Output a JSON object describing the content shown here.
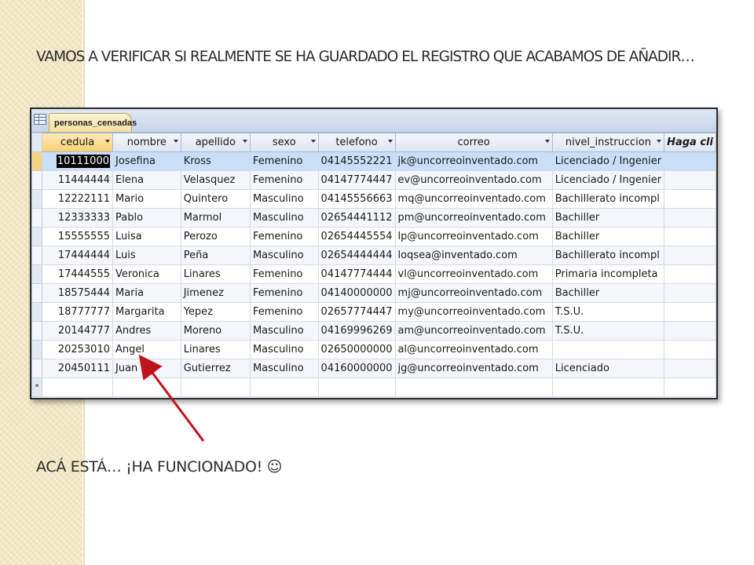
{
  "heading": "VAMOS A VERIFICAR SI REALMENTE SE HA GUARDADO EL REGISTRO QUE ACABAMOS DE AÑADIR…",
  "footer_message": "ACÁ ESTÁ… ¡HA FUNCIONADO! ☺",
  "tab": {
    "label": "personas_censadas",
    "icon": "table-icon"
  },
  "columns": [
    {
      "label": "cedula"
    },
    {
      "label": "nombre"
    },
    {
      "label": "apellido"
    },
    {
      "label": "sexo"
    },
    {
      "label": "telefono"
    },
    {
      "label": "correo"
    },
    {
      "label": "nivel_instruccion"
    },
    {
      "label": "Haga cli"
    }
  ],
  "rows": [
    [
      "10111000",
      "Josefina",
      "Kross",
      "Femenino",
      "04145552221",
      "jk@uncorreoinventado.com",
      "Licenciado / Ingenier",
      ""
    ],
    [
      "11444444",
      "Elena",
      "Velasquez",
      "Femenino",
      "04147774447",
      "ev@uncorreoinventado.com",
      "Licenciado / Ingenier",
      ""
    ],
    [
      "12222111",
      "Mario",
      "Quintero",
      "Masculino",
      "04145556663",
      "mq@uncorreoinventado.com",
      "Bachillerato incompl",
      ""
    ],
    [
      "12333333",
      "Pablo",
      "Marmol",
      "Masculino",
      "02654441112",
      "pm@uncorreoinventado.com",
      "Bachiller",
      ""
    ],
    [
      "15555555",
      "Luisa",
      "Perozo",
      "Femenino",
      "02654445554",
      "lp@uncorreoinventado.com",
      "Bachiller",
      ""
    ],
    [
      "17444444",
      "Luis",
      "Peña",
      "Masculino",
      "02654444444",
      "loqsea@inventado.com",
      "Bachillerato incompl",
      ""
    ],
    [
      "17444555",
      "Veronica",
      "Linares",
      "Femenino",
      "04147774444",
      "vl@uncorreoinventado.com",
      "Primaria incompleta",
      ""
    ],
    [
      "18575444",
      "Maria",
      "Jimenez",
      "Femenino",
      "04140000000",
      "mj@uncorreoinventado.com",
      "Bachiller",
      ""
    ],
    [
      "18777777",
      "Margarita",
      "Yepez",
      "Femenino",
      "02657774447",
      "my@uncorreoinventado.com",
      "T.S.U.",
      ""
    ],
    [
      "20144777",
      "Andres",
      "Moreno",
      "Masculino",
      "04169996269",
      "am@uncorreoinventado.com",
      "T.S.U.",
      ""
    ],
    [
      "20253010",
      "Angel",
      "Linares",
      "Masculino",
      "02650000000",
      "al@uncorreoinventado.com",
      "",
      ""
    ],
    [
      "20450111",
      "Juan",
      "Gutierrez",
      "Masculino",
      "04160000000",
      "jg@uncorreoinventado.com",
      "Licenciado",
      ""
    ]
  ],
  "new_row_marker": "*",
  "colors": {
    "arrow": "#c0141c",
    "selected_row": "#c9def8",
    "tab": "#f5df9c"
  }
}
